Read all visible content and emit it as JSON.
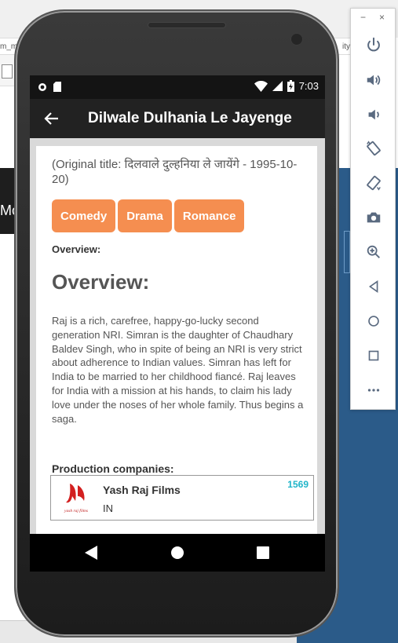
{
  "desktop": {
    "left_fragment": "m_m",
    "right_fragment": "ity",
    "side_fragment": "Mo"
  },
  "emulator_toolbar": {
    "minimize": "−",
    "close": "×",
    "tools": [
      "power-icon",
      "volume-up-icon",
      "volume-down-icon",
      "rotate-left-icon",
      "rotate-right-icon",
      "camera-icon",
      "zoom-icon",
      "back-icon",
      "home-icon",
      "overview-icon",
      "more-icon"
    ]
  },
  "status_bar": {
    "time": "7:03"
  },
  "app_bar": {
    "title": "Dilwale Dulhania Le Jayenge"
  },
  "movie": {
    "original_title_line": "(Original title: दिलवाले दुल्हनिया ले जायेंगे - 1995-10-20)",
    "genres": [
      "Comedy",
      "Drama",
      "Romance"
    ],
    "overview_label_small": "Overview:",
    "overview_label_big": "Overview:",
    "overview_text": "Raj is a rich, carefree, happy-go-lucky second generation NRI. Simran is the daughter of Chaudhary Baldev Singh, who in spite of being an NRI is very strict about adherence to Indian values. Simran has left for India to be married to her childhood fiancé. Raj leaves for India with a mission at his hands, to claim his lady love under the noses of her whole family. Thus begins a saga.",
    "production_label": "Production companies:",
    "companies": [
      {
        "name": "Yash Raj Films",
        "country": "IN",
        "id": "1569",
        "logo_text": "yash raj films"
      }
    ]
  },
  "colors": {
    "genre_bg": "#f58e50",
    "company_id": "#20b5c9",
    "appbar": "#222222"
  }
}
